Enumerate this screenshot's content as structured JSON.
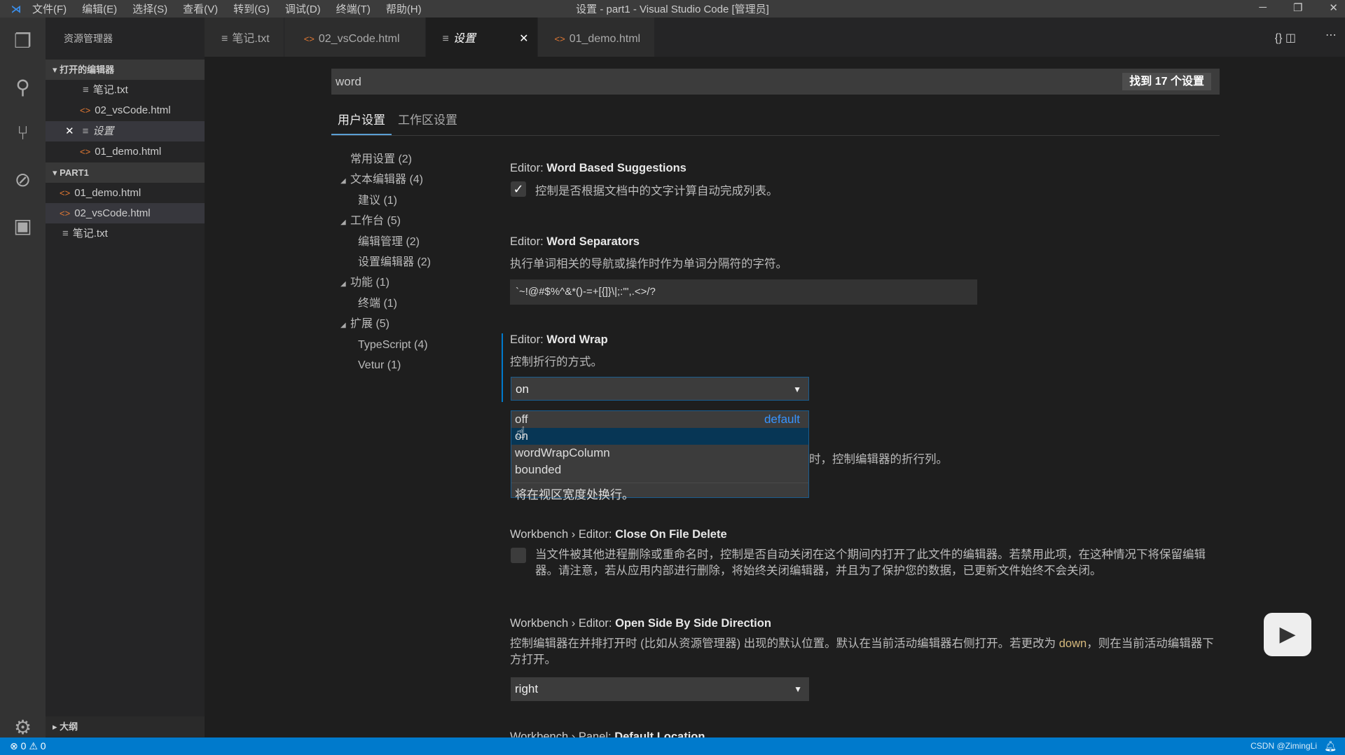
{
  "titlebar": {
    "menus": [
      "文件(F)",
      "编辑(E)",
      "选择(S)",
      "查看(V)",
      "转到(G)",
      "调试(D)",
      "终端(T)",
      "帮助(H)"
    ],
    "title": "设置 - part1 - Visual Studio Code [管理员]"
  },
  "activity": {
    "icons": [
      "files-icon",
      "search-icon",
      "source-control-icon",
      "debug-icon",
      "extensions-icon",
      "gear-icon"
    ]
  },
  "sidebar": {
    "title": "资源管理器",
    "open_editors_label": "打开的编辑器",
    "open_editors": [
      "笔记.txt",
      "02_vsCode.html",
      "设置",
      "01_demo.html"
    ],
    "folder_label": "PART1",
    "files": [
      "01_demo.html",
      "02_vsCode.html",
      "笔记.txt"
    ],
    "outline_label": "大纲"
  },
  "tabs": [
    {
      "label": "笔记.txt"
    },
    {
      "label": "02_vsCode.html"
    },
    {
      "label": "设置"
    },
    {
      "label": "01_demo.html"
    }
  ],
  "search": {
    "value": "word",
    "found": "找到 17 个设置"
  },
  "settings_tabs": [
    "用户设置",
    "工作区设置"
  ],
  "toc": [
    "常用设置 (2)",
    "文本编辑器 (4)",
    "建议 (1)",
    "工作台 (5)",
    "编辑管理 (2)",
    "设置编辑器 (2)",
    "功能 (1)",
    "终端 (1)",
    "扩展 (5)",
    "TypeScript (4)",
    "Vetur (1)"
  ],
  "settings": {
    "s1": {
      "prefix": "Editor: ",
      "name": "Word Based Suggestions",
      "desc": "控制是否根据文档中的文字计算自动完成列表。",
      "checked": true
    },
    "s2": {
      "prefix": "Editor: ",
      "name": "Word Separators",
      "desc": "执行单词相关的导航或操作时作为单词分隔符的字符。",
      "value": "`~!@#$%^&*()-=+[{]}\\|;:'\",.<>/?"
    },
    "s3": {
      "prefix": "Editor: ",
      "name": "Word Wrap",
      "desc": "控制折行的方式。",
      "value": "on",
      "options": [
        "off",
        "on",
        "wordWrapColumn",
        "bounded"
      ],
      "default_label": "default",
      "option_desc": "将在视区宽度处换行。",
      "hidden_desc_tail": "时，控制编辑器的折行列。"
    },
    "s4": {
      "prefix": "Workbench › Editor: ",
      "name": "Close On File Delete",
      "desc": "当文件被其他进程删除或重命名时，控制是否自动关闭在这个期间内打开了此文件的编辑器。若禁用此项，在这种情况下将保留编辑器。请注意，若从应用内部进行删除，将始终关闭编辑器，并且为了保护您的数据，已更新文件始终不会关闭。",
      "checked": false
    },
    "s5": {
      "prefix": "Workbench › Editor: ",
      "name": "Open Side By Side Direction",
      "desc_a": "控制编辑器在并排打开时 (比如从资源管理器) 出现的默认位置。默认在当前活动编辑器右侧打开。若更改为 ",
      "desc_code": "down",
      "desc_b": "，则在当前活动编辑器下方打开。",
      "value": "right"
    },
    "s6": {
      "prefix": "Workbench › Panel: ",
      "name": "Default Location"
    }
  },
  "statusbar": {
    "errors": "0",
    "warnings": "0",
    "watermark": "CSDN @ZimingLi"
  },
  "colors": {
    "accent": "#007acc",
    "code": "#d7ba7d",
    "default_link": "#3794ff"
  }
}
